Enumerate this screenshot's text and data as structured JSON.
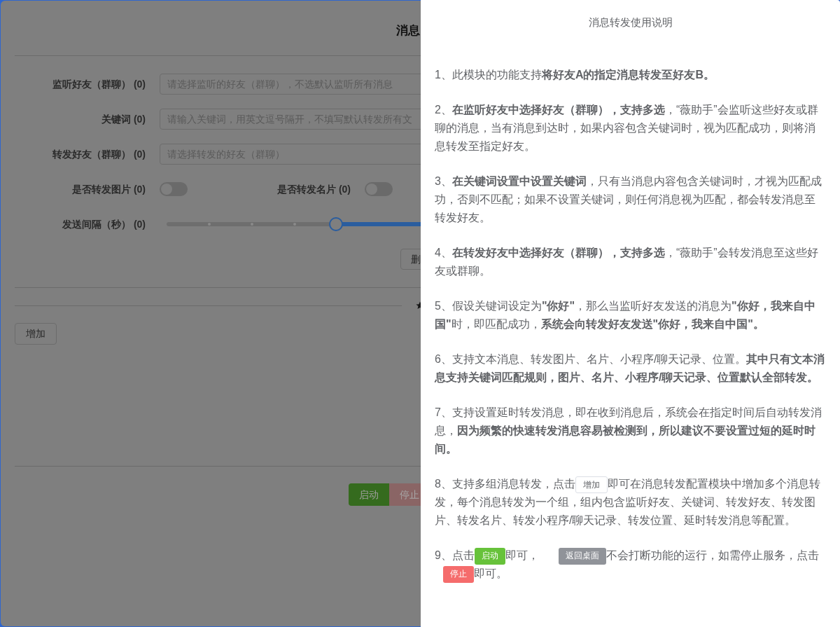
{
  "form": {
    "title": "消息",
    "fields": [
      {
        "label": "监听好友（群聊） (0)",
        "placeholder": "请选择监听的好友（群聊），不选默认监听所有消息"
      },
      {
        "label": "关键词 (0)",
        "placeholder": "请输入关键词，用英文逗号隔开，不填写默认转发所有文"
      },
      {
        "label": "转发好友（群聊） (0)",
        "placeholder": "请选择转发的好友（群聊）"
      }
    ],
    "switches": [
      {
        "label": "是否转发图片 (0)",
        "on": false
      },
      {
        "label": "是否转发名片 (0)",
        "on": false
      }
    ],
    "interval": {
      "label": "发送间隔（秒） (0)",
      "level": 0.33
    },
    "delete_button": "删",
    "add_button": "增加",
    "actions": [
      {
        "kind": "success",
        "label": "启动"
      },
      {
        "kind": "danger",
        "label": "停止"
      }
    ]
  },
  "drawer": {
    "title": "消息转发使用说明",
    "paragraphs": [
      {
        "parts": [
          {
            "kind": "text",
            "text": "1、此模块的功能支持**将好友A的指定消息转发至好友B。**"
          }
        ]
      },
      {
        "parts": [
          {
            "kind": "text",
            "text": "2、**在监听好友中选择好友（群聊），支持多选**，“薇助手”会监听这些好友或群聊的消息，当有消息到达时，如果内容包含关键词时，视为匹配成功，则将消息转发至指定好友。"
          }
        ]
      },
      {
        "parts": [
          {
            "kind": "text",
            "text": "3、**在关键词设置中设置关键词**，只有当消息内容包含关键词时，才视为匹配成功，否则不匹配；如果不设置关键词，则任何消息视为匹配，都会转发消息至转发好友。"
          }
        ]
      },
      {
        "parts": [
          {
            "kind": "text",
            "text": "4、**在转发好友中选择好友（群聊），支持多选**，“薇助手”会转发消息至这些好友或群聊。"
          }
        ]
      },
      {
        "parts": [
          {
            "kind": "text",
            "text": "5、假设关键词设定为**\"你好\"**，那么当监听好友发送的消息为**\"你好，我来自中国\"**时，即匹配成功，**系统会向转发好友发送\"你好，我来自中国\"。**"
          }
        ]
      },
      {
        "parts": [
          {
            "kind": "text",
            "text": "6、支持文本消息、转发图片、名片、小程序/聊天记录、位置。**其中只有文本消息支持关键词匹配规则，图片、名片、小程序/聊天记录、位置默认全部转发。**"
          }
        ]
      },
      {
        "parts": [
          {
            "kind": "text",
            "text": "7、支持设置延时转发消息，即在收到消息后，系统会在指定时间后自动转发消息，**因为频繁的快速转发消息容易被检测到，所以建议不要设置过短的延时时间。**"
          }
        ]
      },
      {
        "parts": [
          {
            "kind": "text",
            "text": "8、支持多组消息转发，点击"
          },
          {
            "kind": "plain",
            "text": "增加"
          },
          {
            "kind": "text",
            "text": "即可在消息转发配置模块中增加多个消息转发，每个消息转发为一个组，组内包含监听好友、关键词、转发好友、转发图片、转发名片、转发小程序/聊天记录、转发位置、延时转发消息等配置。"
          }
        ]
      },
      {
        "parts": [
          {
            "kind": "text",
            "text": "9、点击"
          },
          {
            "kind": "success",
            "text": "启动"
          },
          {
            "kind": "text",
            "text": "即可，"
          },
          {
            "kind": "info",
            "text": "返回桌面"
          },
          {
            "kind": "text",
            "text": "不会打断功能的运行，如需停止服务，点击"
          },
          {
            "kind": "danger",
            "text": "停止"
          },
          {
            "kind": "text",
            "text": "即可。"
          }
        ]
      }
    ]
  }
}
